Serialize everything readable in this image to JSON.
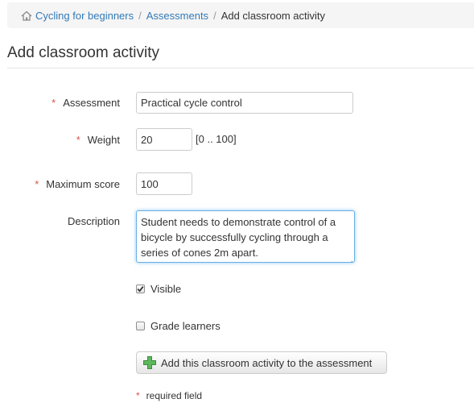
{
  "breadcrumb": {
    "items": [
      "Cycling for beginners",
      "Assessments"
    ],
    "separator": "/",
    "current": "Add classroom activity"
  },
  "page": {
    "title": "Add classroom activity"
  },
  "form": {
    "required_marker": "*",
    "assessment": {
      "label": "Assessment",
      "value": "Practical cycle control"
    },
    "weight": {
      "label": "Weight",
      "value": "20",
      "range_hint": "[0 .. 100]"
    },
    "max_score": {
      "label": "Maximum score",
      "value": "100"
    },
    "description": {
      "label": "Description",
      "value": "Student needs to demonstrate control of a bicycle by successfully cycling through a series of cones 2m apart."
    },
    "visible": {
      "label": "Visible",
      "checked": true
    },
    "grade_learners": {
      "label": "Grade learners",
      "checked": false
    },
    "submit_label": "Add this classroom activity to the assessment",
    "required_note": "required field"
  },
  "colors": {
    "link": "#337ab7",
    "required": "#d9534f",
    "focus": "#66afe9",
    "add_icon": "#5cb85c"
  }
}
